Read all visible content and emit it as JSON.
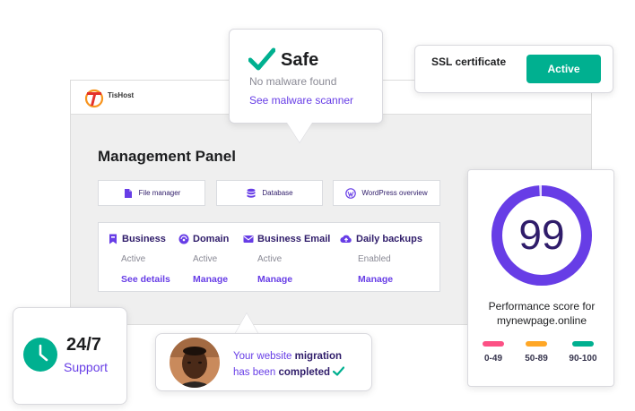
{
  "brand": {
    "name": "TisHost"
  },
  "management": {
    "title": "Management Panel",
    "quick_links": [
      {
        "label": "File manager",
        "icon": "file-icon"
      },
      {
        "label": "Database",
        "icon": "database-icon"
      },
      {
        "label": "WordPress overview",
        "icon": "wordpress-icon"
      }
    ],
    "services": [
      {
        "name": "Business",
        "status": "Active",
        "action": "See details",
        "icon": "bookmark-icon"
      },
      {
        "name": "Domain",
        "status": "Active",
        "action": "Manage",
        "icon": "globe-icon"
      },
      {
        "name": "Business Email",
        "status": "Active",
        "action": "Manage",
        "icon": "mail-icon"
      },
      {
        "name": "Daily backups",
        "status": "Enabled",
        "action": "Manage",
        "icon": "cloud-upload-icon"
      }
    ]
  },
  "malware": {
    "title": "Safe",
    "subtitle": "No malware found",
    "link": "See malware scanner"
  },
  "ssl": {
    "label": "SSL certificate",
    "status": "Active"
  },
  "performance": {
    "score": "99",
    "score_fraction": 0.99,
    "label": "Performance score for mynewpage.online",
    "legend": [
      {
        "range": "0-49",
        "color": "#fc5185"
      },
      {
        "range": "50-89",
        "color": "#ffa726"
      },
      {
        "range": "90-100",
        "color": "#00b090"
      }
    ]
  },
  "support": {
    "time": "24/7",
    "label": "Support"
  },
  "migration": {
    "text_1": "Your website ",
    "bold_1": "migration",
    "text_2": "has been ",
    "bold_2": "completed"
  },
  "colors": {
    "accent": "#673de6",
    "dark": "#2f1c6a",
    "success": "#00b090"
  }
}
